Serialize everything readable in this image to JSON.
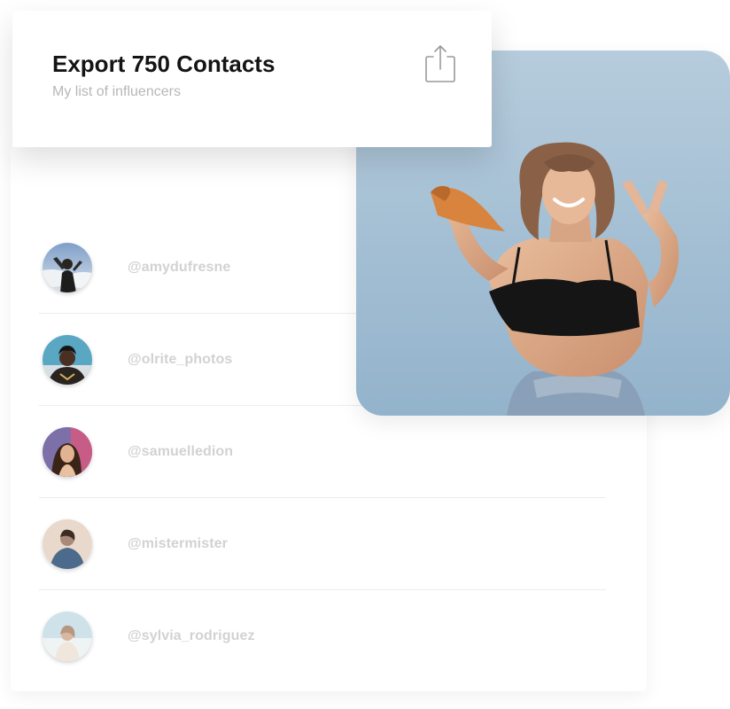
{
  "header": {
    "title": "Export 750 Contacts",
    "subtitle": "My list of influencers",
    "export_icon": "share-upload-icon"
  },
  "contacts": [
    {
      "handle": "@amydufresne",
      "avatar_icon": "avatar-photo"
    },
    {
      "handle": "@olrite_photos",
      "avatar_icon": "avatar-photo"
    },
    {
      "handle": "@samuelledion",
      "avatar_icon": "avatar-photo"
    },
    {
      "handle": "@mistermister",
      "avatar_icon": "avatar-photo"
    },
    {
      "handle": "@sylvia_rodriguez",
      "avatar_icon": "avatar-photo"
    }
  ],
  "colors": {
    "title": "#141414",
    "subtitle": "#b7b7b7",
    "handle": "#d2d2d2",
    "sky": "#a9c3d6"
  }
}
